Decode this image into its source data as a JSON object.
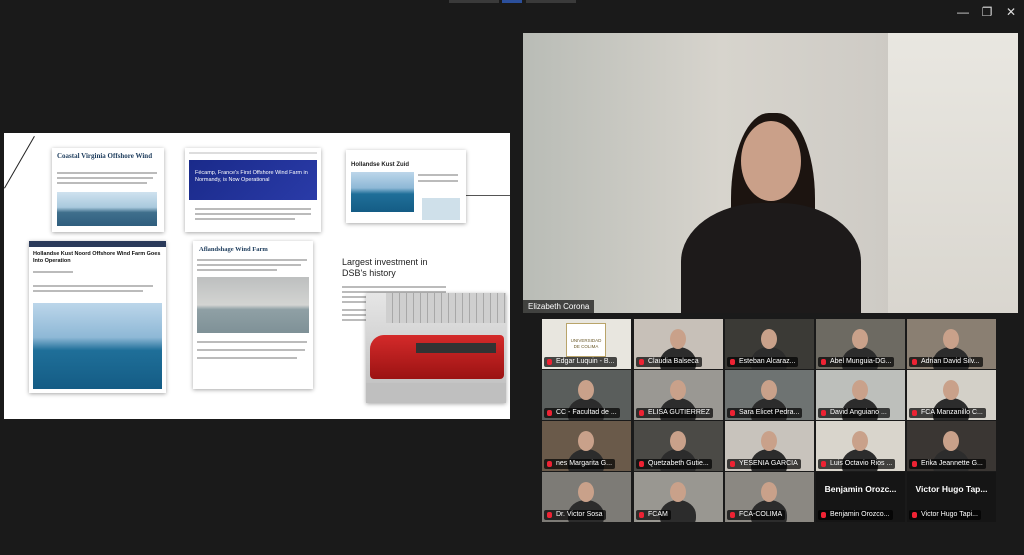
{
  "window": {
    "controls": {
      "minimize": "—",
      "maximize": "❐",
      "close": "✕"
    }
  },
  "shared_screen": {
    "cards": [
      {
        "title": "Coastal Virginia Offshore Wind"
      },
      {
        "title": "Fécamp, France's First Offshore Wind Farm in Normandy, is Now Operational"
      },
      {
        "title": "Hollandse Kust Zuid"
      },
      {
        "title": "Hollandse Kust Noord Offshore Wind Farm Goes Into Operation"
      },
      {
        "title": "Aflandshage Wind Farm"
      },
      {
        "title": "Largest investment in DSB's history"
      }
    ]
  },
  "speaker": {
    "name": "Elizabeth Corona"
  },
  "participants": [
    {
      "name": "Edgar Luquin - B..."
    },
    {
      "name": "Claudia Balseca"
    },
    {
      "name": "Esteban Alcaraz..."
    },
    {
      "name": "Abel Munguia-DG..."
    },
    {
      "name": "Adrian David Silv..."
    },
    {
      "name": "CC - Facultad de ..."
    },
    {
      "name": "ELISA GUTIERREZ"
    },
    {
      "name": "Sara Elicet Pedra..."
    },
    {
      "name": "David Anguiano ..."
    },
    {
      "name": "FCA Manzanillo C..."
    },
    {
      "name": "nes Margarita G..."
    },
    {
      "name": "Quetzabeth Gutie..."
    },
    {
      "name": "YESENIA GARCIA"
    },
    {
      "name": "Luis Octavio Rios ..."
    },
    {
      "name": "Erika Jeannette G..."
    },
    {
      "name": "Dr. Victor Sosa"
    },
    {
      "name": "FCAM"
    },
    {
      "name": "FCA-COLIMA"
    },
    {
      "name": "Benjamin Orozco...",
      "display": "Benjamin Orozc..."
    },
    {
      "name": "Victor Hugo Tapi...",
      "display": "Victor Hugo Tap..."
    }
  ],
  "logo_tile_text": "UNIVERSIDAD DE COLIMA"
}
